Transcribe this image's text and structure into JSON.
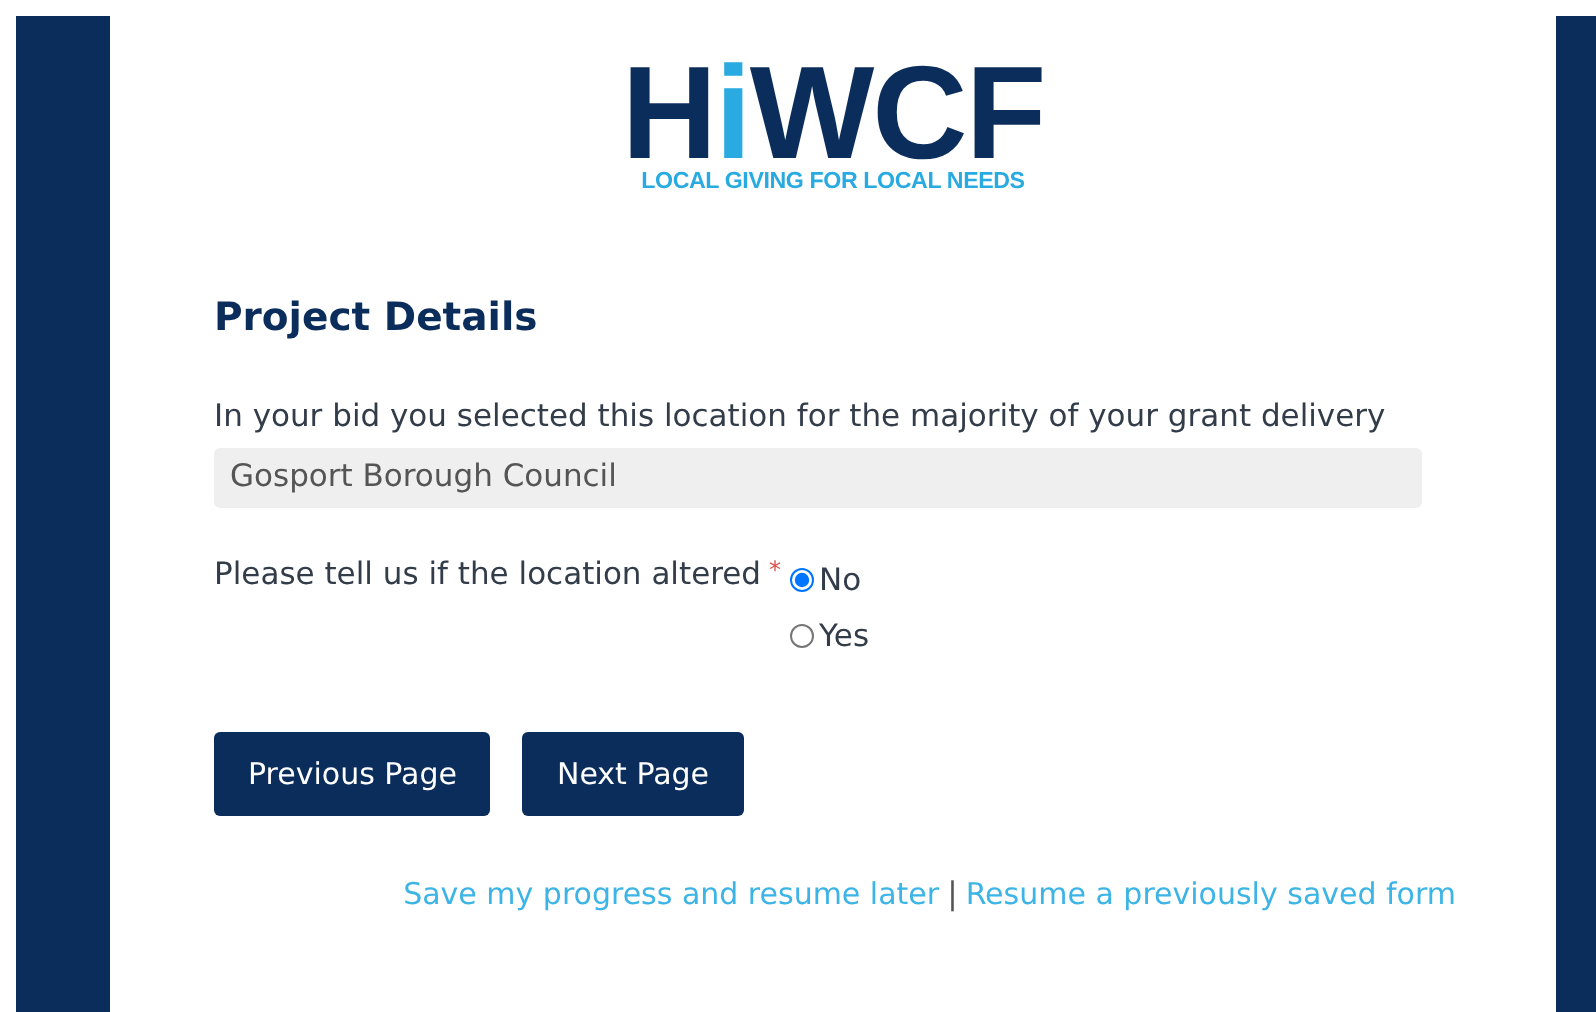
{
  "logo": {
    "parts": [
      {
        "text": "H",
        "color": "#0b2d5b"
      },
      {
        "text": "i",
        "color": "#29abe2"
      },
      {
        "text": "WCF",
        "color": "#0b2d5b"
      }
    ],
    "tagline": "LOCAL GIVING FOR LOCAL NEEDS"
  },
  "section_title": "Project Details",
  "location_field": {
    "label": "In your bid you selected this location for the majority of your grant delivery",
    "value": "Gosport Borough Council"
  },
  "question": {
    "label": "Please tell us if the location altered",
    "required_mark": "*",
    "options": [
      {
        "label": "No",
        "selected": true
      },
      {
        "label": "Yes",
        "selected": false
      }
    ]
  },
  "buttons": [
    "Previous Page",
    "Next Page"
  ],
  "footer_links": {
    "save": "Save my progress and resume later",
    "separator": "|",
    "resume": "Resume a previously saved form"
  }
}
